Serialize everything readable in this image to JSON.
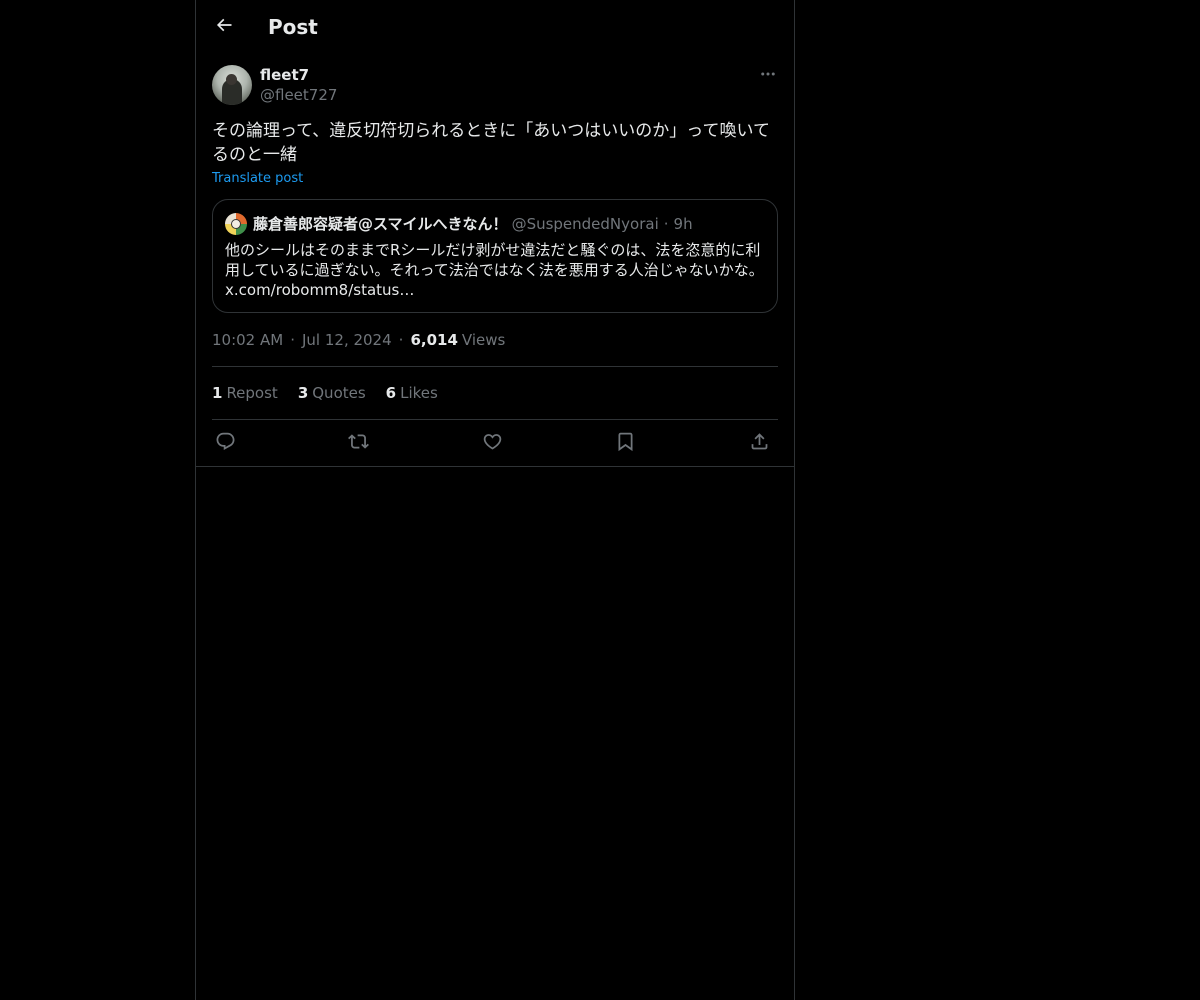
{
  "header": {
    "title": "Post",
    "back_icon": "arrow-left-icon"
  },
  "post": {
    "author": {
      "display_name": "fleet7",
      "handle": "@fleet727"
    },
    "text": "その論理って、違反切符切られるときに「あいつはいいのか」って喚いてるのと一緒",
    "translate_label": "Translate post",
    "quoted": {
      "display_name": "藤倉善郎容疑者@スマイルへきなん！",
      "handle": "@SuspendedNyorai",
      "separator": "·",
      "time": "9h",
      "text": "他のシールはそのままでRシールだけ剥がせ違法だと騒ぐのは、法を恣意的に利用しているに過ぎない。それって法治ではなく法を悪用する人治じゃないかな。 x.com/robomm8/status…"
    },
    "time": "10:02 AM",
    "date": "Jul 12, 2024",
    "separator": "·",
    "views_count": "6,014",
    "views_label": "Views",
    "stats": {
      "reposts_count": "1",
      "reposts_label": "Repost",
      "quotes_count": "3",
      "quotes_label": "Quotes",
      "likes_count": "6",
      "likes_label": "Likes"
    }
  },
  "actions": [
    "reply-icon",
    "repost-icon",
    "like-icon",
    "bookmark-icon",
    "share-icon"
  ],
  "colors": {
    "background": "#000000",
    "text": "#e7e9ea",
    "muted": "#71767b",
    "link": "#1d9bf0",
    "border": "#2f3336"
  }
}
